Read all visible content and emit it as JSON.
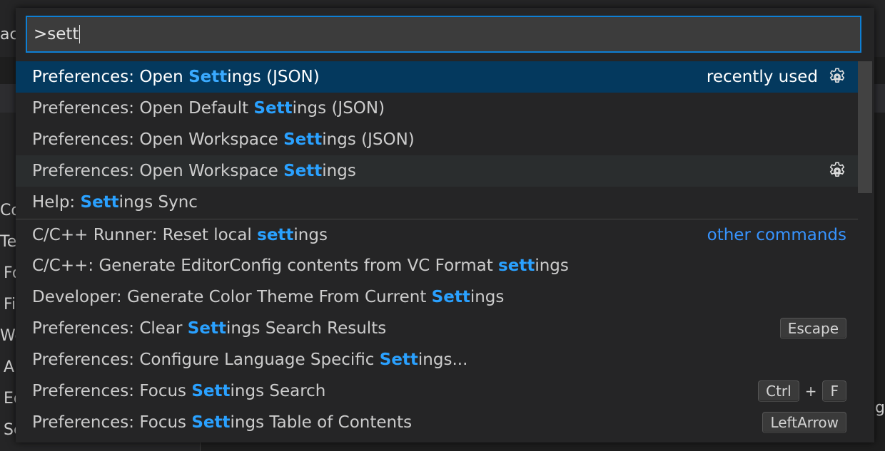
{
  "background": {
    "top_left_fragment": "ac",
    "left_fragments": [
      "Co",
      "Tex",
      "Fo",
      "Fi",
      "Wo",
      "A",
      "Ed",
      "Se"
    ],
    "right_fragment": "ng"
  },
  "quick_input": {
    "value": ">sett"
  },
  "items": [
    {
      "pre": "Preferences: Open ",
      "hl": "Sett",
      "post": "ings (JSON)",
      "meta": "recently used",
      "gear": true,
      "selected": true
    },
    {
      "pre": "Preferences: Open Default ",
      "hl": "Sett",
      "post": "ings (JSON)"
    },
    {
      "pre": "Preferences: Open Workspace ",
      "hl": "Sett",
      "post": "ings (JSON)"
    },
    {
      "pre": "Preferences: Open Workspace ",
      "hl": "Sett",
      "post": "ings",
      "gear": true,
      "hover": true
    },
    {
      "pre": "Help: ",
      "hl": "Sett",
      "post": "ings Sync"
    },
    {
      "pre": "C/C++ Runner: Reset local ",
      "hl": "sett",
      "post": "ings",
      "other": "other commands",
      "sep": true
    },
    {
      "pre": "C/C++: Generate EditorConfig contents from VC Format ",
      "hl": "sett",
      "post": "ings"
    },
    {
      "pre": "Developer: Generate Color Theme From Current ",
      "hl": "Sett",
      "post": "ings"
    },
    {
      "pre": "Preferences: Clear ",
      "hl": "Sett",
      "post": "ings Search Results",
      "keys": [
        "Escape"
      ]
    },
    {
      "pre": "Preferences: Configure Language Specific ",
      "hl": "Sett",
      "post": "ings..."
    },
    {
      "pre": "Preferences: Focus ",
      "hl": "Sett",
      "post": "ings Search",
      "keys": [
        "Ctrl",
        "F"
      ]
    },
    {
      "pre": "Preferences: Focus ",
      "hl": "Sett",
      "post": "ings Table of Contents",
      "keys": [
        "LeftArrow"
      ]
    }
  ],
  "colors": {
    "accent": "#0e7fd4",
    "highlight": "#2aa1ff",
    "selected_bg": "#04395e",
    "link": "#3794ff"
  }
}
